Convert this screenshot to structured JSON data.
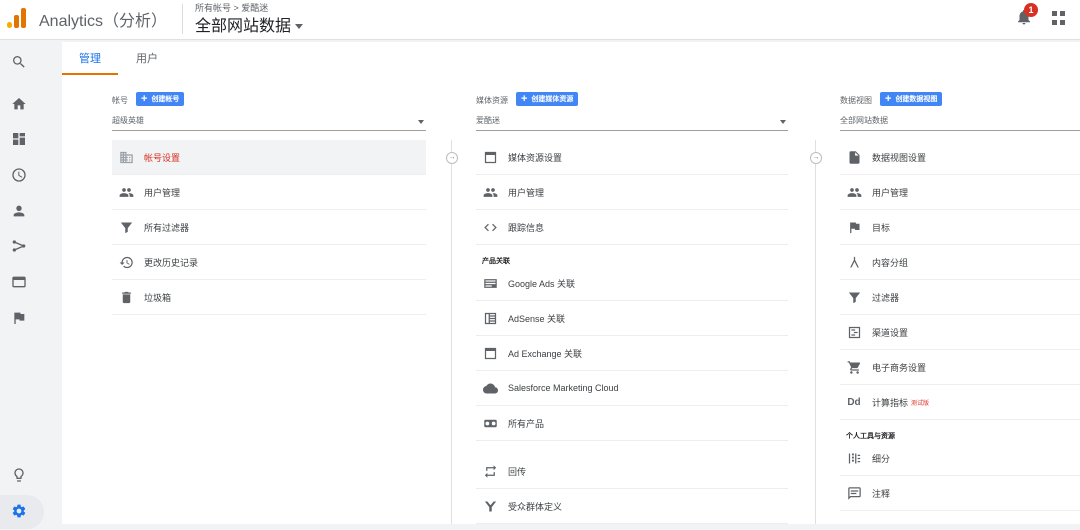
{
  "app": {
    "title": "Analytics（分析）"
  },
  "header": {
    "breadcrumb": "所有帐号 > 爱酷迷",
    "view_name": "全部网站数据",
    "notification_count": "1"
  },
  "tabs": [
    {
      "label": "管理",
      "active": true
    },
    {
      "label": "用户",
      "active": false
    }
  ],
  "columns": {
    "account": {
      "header": "帐号",
      "create_label": "创建帐号",
      "selected": "超级英雄",
      "items": [
        {
          "label": "帐号设置",
          "icon": "building-icon",
          "selected": true
        },
        {
          "label": "用户管理",
          "icon": "people-icon"
        },
        {
          "label": "所有过滤器",
          "icon": "filter-icon"
        },
        {
          "label": "更改历史记录",
          "icon": "history-icon"
        },
        {
          "label": "垃圾箱",
          "icon": "trash-icon"
        }
      ]
    },
    "property": {
      "header": "媒体资源",
      "create_label": "创建媒体资源",
      "selected": "爱酷迷",
      "items": [
        {
          "label": "媒体资源设置",
          "icon": "window-icon"
        },
        {
          "label": "用户管理",
          "icon": "people-icon"
        },
        {
          "label": "跟踪信息",
          "icon": "code-icon"
        }
      ],
      "section_label": "产品关联",
      "linked_items": [
        {
          "label": "Google Ads 关联",
          "icon": "ads-icon"
        },
        {
          "label": "AdSense 关联",
          "icon": "adsense-icon"
        },
        {
          "label": "Ad Exchange 关联",
          "icon": "window-icon"
        },
        {
          "label": "Salesforce Marketing Cloud",
          "icon": "cloud-icon"
        },
        {
          "label": "所有产品",
          "icon": "products-icon"
        }
      ],
      "bottom_items": [
        {
          "label": "回传",
          "icon": "postback-icon"
        },
        {
          "label": "受众群体定义",
          "icon": "audience-icon"
        }
      ]
    },
    "view": {
      "header": "数据视图",
      "create_label": "创建数据视图",
      "selected": "全部网站数据",
      "items": [
        {
          "label": "数据视图设置",
          "icon": "document-icon"
        },
        {
          "label": "用户管理",
          "icon": "people-icon"
        },
        {
          "label": "目标",
          "icon": "flag-icon"
        },
        {
          "label": "内容分组",
          "icon": "grouping-icon"
        },
        {
          "label": "过滤器",
          "icon": "filter-icon"
        },
        {
          "label": "渠道设置",
          "icon": "channel-icon"
        },
        {
          "label": "电子商务设置",
          "icon": "cart-icon"
        },
        {
          "label": "计算指标",
          "sub": "测试版",
          "icon": "dd-icon"
        }
      ],
      "section_label": "个人工具与资源",
      "tool_items": [
        {
          "label": "细分",
          "icon": "segments-icon"
        },
        {
          "label": "注释",
          "icon": "annotation-icon"
        }
      ]
    }
  }
}
